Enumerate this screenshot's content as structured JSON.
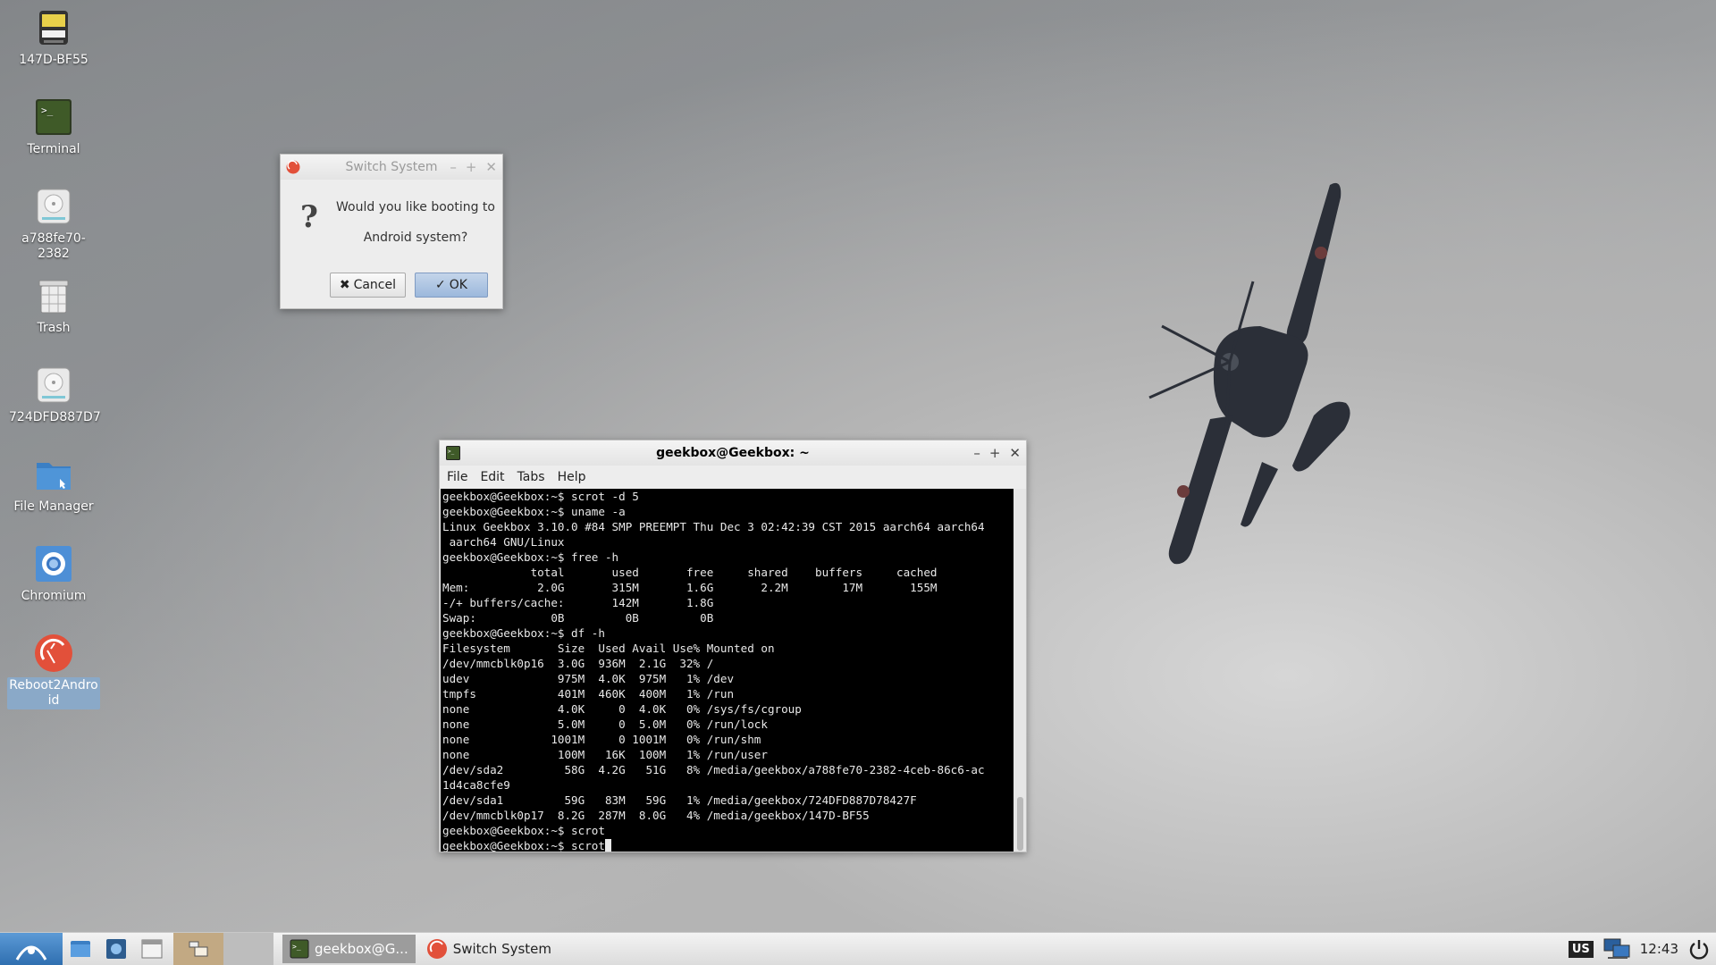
{
  "desktop_icons": [
    {
      "label": "147D-BF55",
      "icon": "usb-drive-icon"
    },
    {
      "label": "Terminal",
      "icon": "terminal-icon"
    },
    {
      "label": "a788fe70-2382",
      "icon": "disk-icon"
    },
    {
      "label": "Trash",
      "icon": "trash-icon"
    },
    {
      "label": "724DFD887D7",
      "icon": "disk-icon"
    },
    {
      "label": "File Manager",
      "icon": "folder-icon"
    },
    {
      "label": "Chromium",
      "icon": "chromium-icon"
    },
    {
      "label": "Reboot2Android",
      "icon": "reboot-android-icon"
    }
  ],
  "dialog": {
    "title": "Switch System",
    "message": "Would you like booting to\nAndroid system?",
    "cancel_label": "Cancel",
    "ok_label": "OK"
  },
  "terminal": {
    "title": "geekbox@Geekbox: ~",
    "menu": [
      "File",
      "Edit",
      "Tabs",
      "Help"
    ],
    "lines": [
      "geekbox@Geekbox:~$ scrot -d 5",
      "geekbox@Geekbox:~$ uname -a",
      "Linux Geekbox 3.10.0 #84 SMP PREEMPT Thu Dec 3 02:42:39 CST 2015 aarch64 aarch64",
      " aarch64 GNU/Linux",
      "geekbox@Geekbox:~$ free -h",
      "             total       used       free     shared    buffers     cached",
      "Mem:          2.0G       315M       1.6G       2.2M        17M       155M",
      "-/+ buffers/cache:       142M       1.8G",
      "Swap:           0B         0B         0B",
      "geekbox@Geekbox:~$ df -h",
      "Filesystem       Size  Used Avail Use% Mounted on",
      "/dev/mmcblk0p16  3.0G  936M  2.1G  32% /",
      "udev             975M  4.0K  975M   1% /dev",
      "tmpfs            401M  460K  400M   1% /run",
      "none             4.0K     0  4.0K   0% /sys/fs/cgroup",
      "none             5.0M     0  5.0M   0% /run/lock",
      "none            1001M     0 1001M   0% /run/shm",
      "none             100M   16K  100M   1% /run/user",
      "/dev/sda2         58G  4.2G   51G   8% /media/geekbox/a788fe70-2382-4ceb-86c6-ac",
      "1d4ca8cfe9",
      "/dev/sda1         59G   83M   59G   1% /media/geekbox/724DFD887D78427F",
      "/dev/mmcblk0p17  8.2G  287M  8.0G   4% /media/geekbox/147D-BF55",
      "geekbox@Geekbox:~$ scrot"
    ],
    "prompt": "geekbox@Geekbox:~$ scrot"
  },
  "taskbar": {
    "tasks": [
      {
        "label": "geekbox@G...",
        "icon": "terminal-icon"
      },
      {
        "label": "Switch System",
        "icon": "reboot-android-icon"
      }
    ],
    "keyboard_layout": "US",
    "clock": "12:43"
  }
}
